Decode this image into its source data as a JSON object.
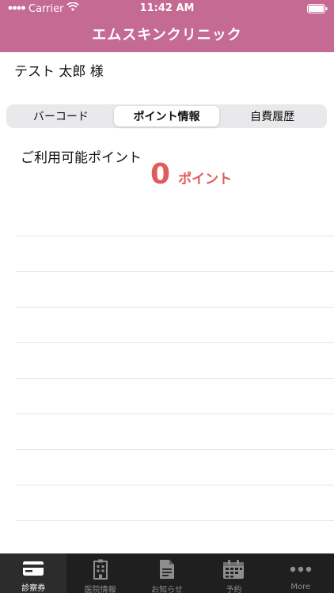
{
  "status_bar": {
    "carrier": "Carrier",
    "time": "11:42 AM"
  },
  "header": {
    "title": "エムスキンクリニック",
    "color": "#c56a93"
  },
  "patient": {
    "name": "テスト 太郎 様"
  },
  "segments": [
    {
      "label": "バーコード",
      "active": false
    },
    {
      "label": "ポイント情報",
      "active": true
    },
    {
      "label": "自費履歴",
      "active": false
    }
  ],
  "points": {
    "label": "ご利用可能ポイント",
    "value": "0",
    "unit": "ポイント",
    "color": "#e25a5a"
  },
  "history": {
    "rows": 9
  },
  "tabbar": {
    "items": [
      {
        "label": "診察券",
        "icon": "card-icon",
        "active": true
      },
      {
        "label": "医院情報",
        "icon": "building-icon",
        "active": false
      },
      {
        "label": "お知らせ",
        "icon": "document-icon",
        "active": false
      },
      {
        "label": "予約",
        "icon": "calendar-icon",
        "active": false
      },
      {
        "label": "More",
        "icon": "more-icon",
        "active": false
      }
    ]
  }
}
